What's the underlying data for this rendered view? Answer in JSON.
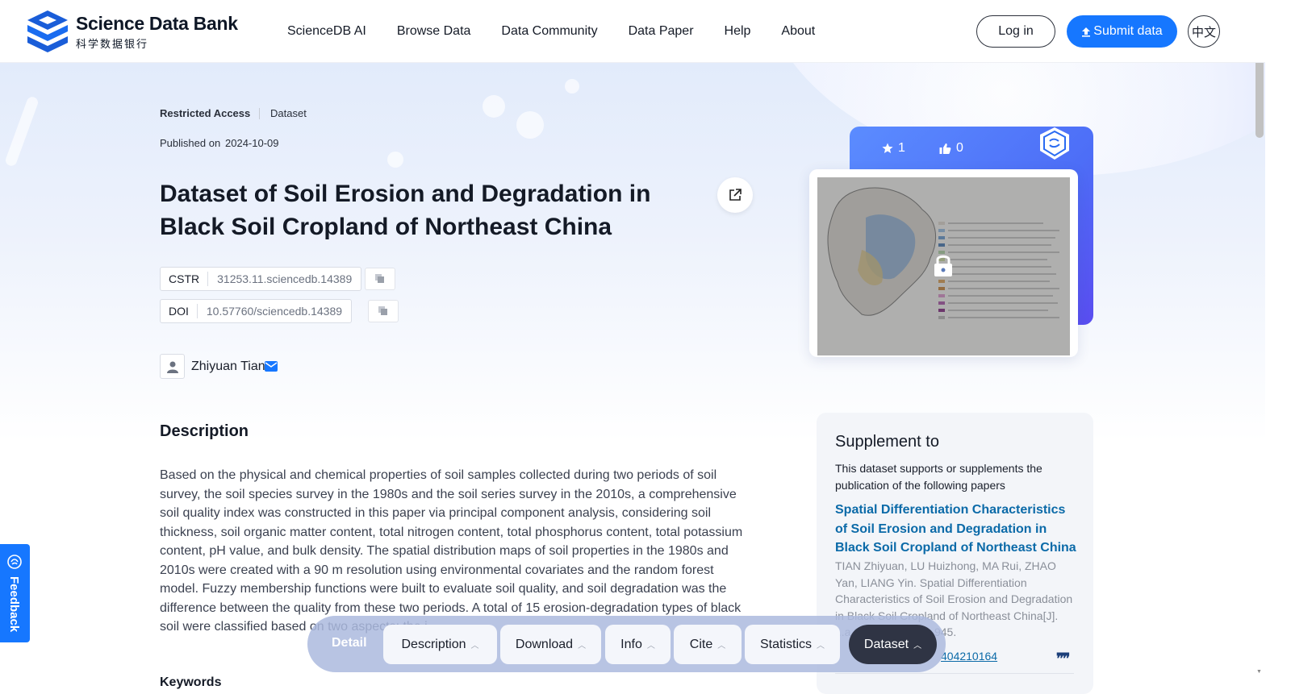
{
  "header": {
    "logo_en": "Science Data Bank",
    "logo_zh": "科学数据银行",
    "nav": [
      "ScienceDB AI",
      "Browse Data",
      "Data Community",
      "Data Paper",
      "Help",
      "About"
    ],
    "login": "Log in",
    "submit": "Submit data",
    "lang": "中文"
  },
  "meta": {
    "access": "Restricted Access",
    "type": "Dataset",
    "published_label": "Published on",
    "published_date": "2024-10-09"
  },
  "dataset": {
    "title": "Dataset of Soil Erosion and Degradation in Black Soil Cropland of Northeast China",
    "cstr_label": "CSTR",
    "cstr_value": "31253.11.sciencedb.14389",
    "doi_label": "DOI",
    "doi_value": "10.57760/sciencedb.14389",
    "author": "Zhiyuan Tian"
  },
  "stats": {
    "stars": "1",
    "likes": "0"
  },
  "description": {
    "heading": "Description",
    "body": "Based on the physical and chemical properties of soil samples collected during two periods of soil survey, the soil species survey in the 1980s and the soil series survey in the 2010s, a comprehensive soil quality index was constructed in this paper via principal component analysis, considering soil thickness, soil organic matter content, total nitrogen content, total phosphorus content, total potassium content, pH value, and bulk density. The spatial distribution maps of soil properties in the 1980s and 2010s were created with a 90 m resolution using environmental covariates and the random forest model. Fuzzy membership functions were built to evaluate soil quality, and soil degradation was the difference between the quality from these two periods. A total of 15 erosion-degradation types of black soil were classified based on two aspects: the i",
    "keywords_heading": "Keywords"
  },
  "supplement": {
    "title": "Supplement to",
    "intro": "This dataset supports or supplements the publication of the following papers",
    "paper_title": "Spatial Differentiation Characteristics of Soil Erosion and Degradation in Black Soil Cropland of Northeast China",
    "citation": "TIAN Zhiyuan, LU Huizhong, MA Rui, ZHAO Yan, LIANG Yin. Spatial Differentiation Characteristics of Soil Erosion and Degradation in Black Soil Cropland of Northeast China[J]. ...a,2025,62(4):931-945.",
    "doi_fragment": "404210164"
  },
  "feedback": {
    "label": "Feedback"
  },
  "floatnav": {
    "detail": "Detail",
    "tabs": [
      "Description",
      "Download",
      "Info",
      "Cite",
      "Statistics"
    ],
    "active": "Dataset"
  },
  "colors": {
    "accent": "#1677ff",
    "link": "#0b6aa8",
    "dark": "#2f3444"
  },
  "icons": [
    "logo-icon",
    "upload-icon",
    "share-icon",
    "copy-icon",
    "user-icon",
    "mail-icon",
    "star-icon",
    "thumbs-up-icon",
    "badge-icon",
    "lock-icon",
    "quote-icon",
    "feedback-icon",
    "chevron-up-icon"
  ]
}
